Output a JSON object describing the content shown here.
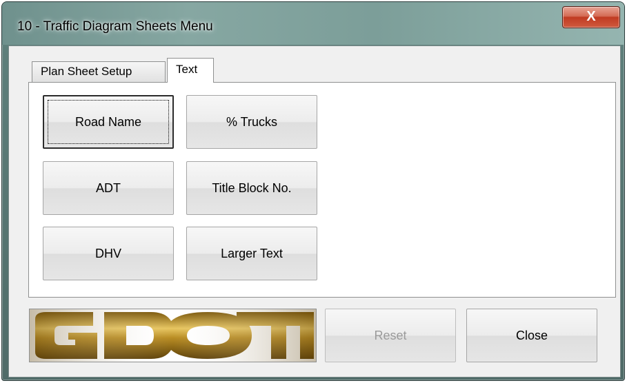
{
  "window": {
    "title": "10 - Traffic Diagram Sheets Menu",
    "close_glyph": "X"
  },
  "tabs": [
    {
      "label": "Plan Sheet Setup",
      "active": false
    },
    {
      "label": "Text",
      "active": true
    }
  ],
  "text_tab": {
    "buttons": [
      {
        "label": "Road Name",
        "focused": true
      },
      {
        "label": "% Trucks"
      },
      {
        "label": "ADT"
      },
      {
        "label": "Title Block No."
      },
      {
        "label": "DHV"
      },
      {
        "label": "Larger Text"
      }
    ]
  },
  "footer": {
    "logo_text": "GDOT",
    "reset_label": "Reset",
    "reset_enabled": false,
    "close_label": "Close"
  },
  "colors": {
    "logo_gold_dark": "#6b4a08",
    "logo_gold_light": "#e7c560",
    "close_button_red": "#c03b22"
  }
}
